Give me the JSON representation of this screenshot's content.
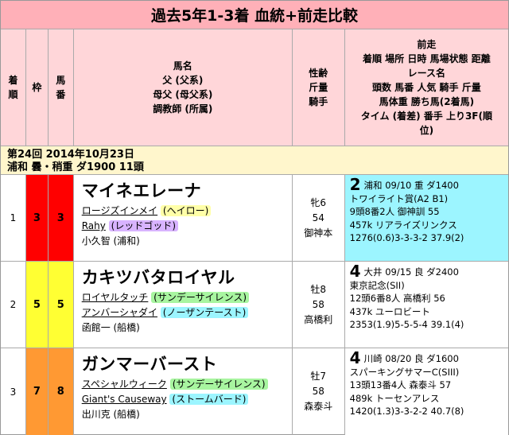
{
  "title": "過去5年1-3着 血統+前走比較",
  "header": {
    "col_rank": [
      "着",
      "順"
    ],
    "col_waku": "枠",
    "col_umaban": [
      "馬",
      "番"
    ],
    "col_horse": [
      "馬名",
      "父 (父系)",
      "母父 (母父系)",
      "調教師 (所属)"
    ],
    "col_rider": [
      "性齢",
      "斤量",
      "騎手"
    ],
    "col_prev": [
      "前走",
      "着順 場所 日時 馬場状態 距離",
      "レース名",
      "頭数 馬番 人気 騎手 斤量",
      "馬体重 勝ち馬(2着馬)",
      "タイム (着差) 番手 上り3F(順",
      "位)"
    ]
  },
  "race": {
    "line1": "第24回 2014年10月23日",
    "line2": "浦和 曇・稍重 ダ1900 11頭"
  },
  "rows": [
    {
      "rank": "1",
      "waku": "3",
      "umaban": "3",
      "waku_color": "#ff0000",
      "bg": "#ffffff",
      "name": "マイネエレーナ",
      "sire": "ロージズインメイ",
      "sire_line": "(ヘイロー)",
      "sire_tag": "yellow",
      "damsire": "Rahy",
      "damsire_line": "(レッドゴッド)",
      "damsire_tag": "purple",
      "trainer": "小久智 (浦和)",
      "sexage": "牝6",
      "weight": "54",
      "jockey": "御神本",
      "prev_bg": "#9cf5ff",
      "prev_pos": "2",
      "prev_l1": "浦和 09/10 重 ダ1400",
      "prev_l2": "トワイライト賞(A2 B1)",
      "prev_l3": "9頭8番2人 御神訓 55",
      "prev_l4": "457k リアライズリンクス",
      "prev_l5": "1276(0.6)3-3-3-2 37.9(2)"
    },
    {
      "rank": "2",
      "waku": "5",
      "umaban": "5",
      "waku_color": "#ffff33",
      "bg": "#ffffff",
      "name": "カキツバタロイヤル",
      "sire": "ロイヤルタッチ",
      "sire_line": "(サンデーサイレンス)",
      "sire_tag": "green",
      "damsire": "アンバーシャダイ",
      "damsire_line": "(ノーザンテースト)",
      "damsire_tag": "cyan",
      "trainer": "函館一 (船橋)",
      "sexage": "牡8",
      "weight": "58",
      "jockey": "高橋利",
      "prev_bg": "#ffffff",
      "prev_pos": "4",
      "prev_l1": "大井 09/15 良 ダ2400",
      "prev_l2": "東京記念(SII)",
      "prev_l3": "12頭6番8人 高橋利 56",
      "prev_l4": "437k ユーロビート",
      "prev_l5": "2353(1.9)5-5-5-4 39.1(4)"
    },
    {
      "rank": "3",
      "waku": "7",
      "umaban": "8",
      "waku_color": "#ff9933",
      "bg": "#ffffff",
      "name": "ガンマーバースト",
      "sire": "スペシャルウィーク",
      "sire_line": "(サンデーサイレンス)",
      "sire_tag": "green",
      "damsire": "Giant's Causeway",
      "damsire_line": "(ストームバード)",
      "damsire_tag": "cyan",
      "trainer": "出川克 (船橋)",
      "sexage": "牡7",
      "weight": "58",
      "jockey": "森泰斗",
      "prev_bg": "#ffffff",
      "prev_pos": "4",
      "prev_l1": "川崎 08/20 良 ダ1600",
      "prev_l2": "スパーキングサマーC(SIII)",
      "prev_l3": "13頭13番4人 森泰斗 57",
      "prev_l4": "489k トーセンアレス",
      "prev_l5": "1420(1.3)3-3-2-2 40.7(8)"
    }
  ]
}
